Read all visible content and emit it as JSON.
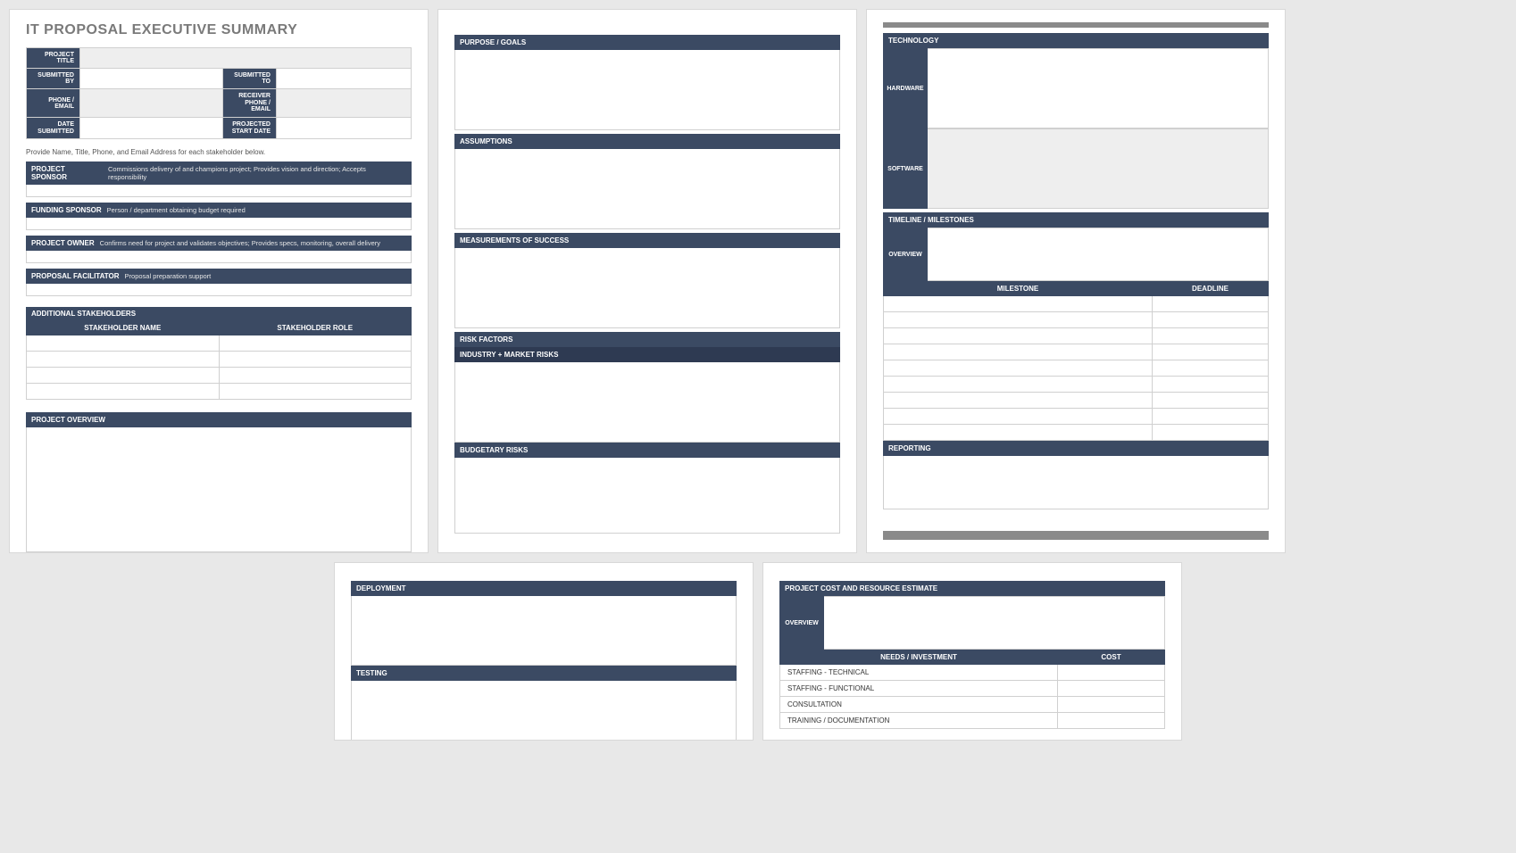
{
  "page1": {
    "title": "IT PROPOSAL EXECUTIVE SUMMARY",
    "projTable": {
      "projectTitle": "PROJECT TITLE",
      "submittedBy": "SUBMITTED BY",
      "submittedTo": "SUBMITTED TO",
      "phoneEmail": "PHONE / EMAIL",
      "receiverPhoneEmail1": "RECEIVER",
      "receiverPhoneEmail2": "PHONE / EMAIL",
      "dateSubmitted1": "DATE",
      "dateSubmitted2": "SUBMITTED",
      "projectedStart1": "PROJECTED",
      "projectedStart2": "START  DATE"
    },
    "note": "Provide Name, Title, Phone, and Email Address for each stakeholder below.",
    "roles": [
      {
        "label": "PROJECT SPONSOR",
        "desc": "Commissions delivery of and champions project; Provides vision and direction; Accepts responsibility"
      },
      {
        "label": "FUNDING SPONSOR",
        "desc": "Person / department obtaining budget required"
      },
      {
        "label": "PROJECT OWNER",
        "desc": "Confirms need for project and validates objectives; Provides specs, monitoring, overall delivery"
      },
      {
        "label": "PROPOSAL FACILITATOR",
        "desc": "Proposal preparation support"
      }
    ],
    "additionalStakeholders": "ADDITIONAL STAKEHOLDERS",
    "stakeNameHeader": "STAKEHOLDER NAME",
    "stakeRoleHeader": "STAKEHOLDER ROLE",
    "projectOverview": "PROJECT OVERVIEW"
  },
  "page2": {
    "purposeGoals": "PURPOSE / GOALS",
    "assumptions": "ASSUMPTIONS",
    "measurements": "MEASUREMENTS OF SUCCESS",
    "riskFactors": "RISK FACTORS",
    "industryMarket": "INDUSTRY + MARKET RISKS",
    "budgetary": "BUDGETARY RISKS"
  },
  "page3": {
    "technology": "TECHNOLOGY",
    "hardware": "HARDWARE",
    "software": "SOFTWARE",
    "timeline": "TIMELINE / MILESTONES",
    "overview": "OVERVIEW",
    "milestoneHeader": "MILESTONE",
    "deadlineHeader": "DEADLINE",
    "reporting": "REPORTING"
  },
  "page4": {
    "deployment": "DEPLOYMENT",
    "testing": "TESTING"
  },
  "page5": {
    "projectCost": "PROJECT COST AND RESOURCE ESTIMATE",
    "overview": "OVERVIEW",
    "needsHeader": "NEEDS / INVESTMENT",
    "costHeader": "COST",
    "rows": [
      "STAFFING - TECHNICAL",
      "STAFFING - FUNCTIONAL",
      "CONSULTATION",
      "TRAINING / DOCUMENTATION"
    ]
  }
}
